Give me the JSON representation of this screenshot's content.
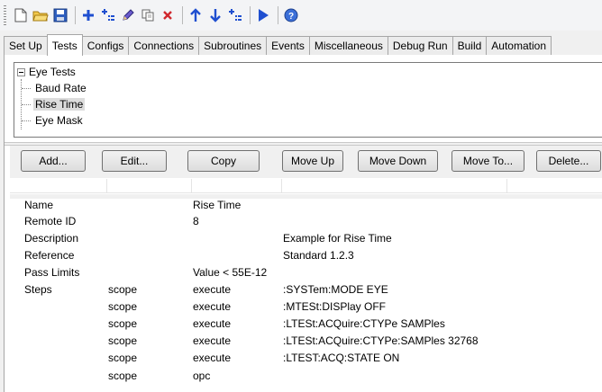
{
  "toolbar": {
    "buttons": [
      {
        "name": "new-icon",
        "glyph": "□"
      },
      {
        "name": "open-folder-icon",
        "glyph": "📂"
      },
      {
        "name": "save-icon",
        "glyph": "💾"
      },
      {
        "name": "add-icon",
        "glyph": "+"
      },
      {
        "name": "add-child-icon",
        "glyph": "⊞"
      },
      {
        "name": "edit-pencil-icon",
        "glyph": "✎"
      },
      {
        "name": "copy-icon",
        "glyph": "⧉"
      },
      {
        "name": "delete-icon",
        "glyph": "×"
      },
      {
        "name": "move-up-icon",
        "glyph": "↑"
      },
      {
        "name": "move-down-icon",
        "glyph": "↓"
      },
      {
        "name": "move-to-icon",
        "glyph": "⊞"
      },
      {
        "name": "run-icon",
        "glyph": "▶"
      },
      {
        "name": "help-icon",
        "glyph": "?"
      }
    ]
  },
  "tabs": [
    "Set Up",
    "Tests",
    "Configs",
    "Connections",
    "Subroutines",
    "Events",
    "Miscellaneous",
    "Debug Run",
    "Build",
    "Automation"
  ],
  "active_tab": "Tests",
  "tree": {
    "root": "Eye Tests",
    "children": [
      "Baud Rate",
      "Rise Time",
      "Eye Mask"
    ],
    "selected": "Rise Time"
  },
  "buttons": {
    "add": "Add...",
    "edit": "Edit...",
    "copy": "Copy",
    "move_up": "Move Up",
    "move_down": "Move Down",
    "move_to": "Move To...",
    "delete": "Delete..."
  },
  "details": {
    "name_label": "Name",
    "name_value": "Rise Time",
    "remote_id_label": "Remote ID",
    "remote_id_value": "8",
    "description_label": "Description",
    "description_value": "Example for Rise Time",
    "reference_label": "Reference",
    "reference_value": "Standard 1.2.3",
    "pass_limits_label": "Pass Limits",
    "pass_limits_value": "Value < 55E-12",
    "steps_label": "Steps",
    "steps": [
      {
        "target": "scope",
        "action": "execute",
        "command": ":SYSTem:MODE EYE"
      },
      {
        "target": "scope",
        "action": "execute",
        "command": ":MTESt:DISPlay OFF"
      },
      {
        "target": "scope",
        "action": "execute",
        "command": ":LTESt:ACQuire:CTYPe SAMPles"
      },
      {
        "target": "scope",
        "action": "execute",
        "command": ":LTESt:ACQuire:CTYPe:SAMPles 32768"
      },
      {
        "target": "scope",
        "action": "execute",
        "command": ":LTEST:ACQ:STATE ON"
      },
      {
        "target": "scope",
        "action": "opc",
        "command": ""
      }
    ]
  },
  "colors": {
    "blue_icon": "#1f4fd0",
    "red_icon": "#d0282e",
    "toolbar_bg": "#f3f4f6",
    "selection": "#dcdcdc"
  }
}
